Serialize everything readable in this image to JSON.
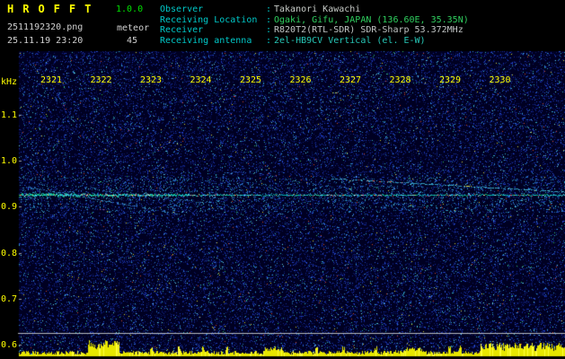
{
  "header": {
    "app_title": "HROFFT",
    "version": "1.0.0",
    "filename": "2511192320.png",
    "mode": "meteor",
    "datetime": "25.11.19 23:20",
    "count": "45",
    "label_color": "#00c8c8",
    "text_color": "#d0d0d0",
    "title_color": "#ffff00",
    "version_color": "#00e000",
    "info": [
      {
        "label": "Observer",
        "value": "Takanori Kawachi",
        "value_color": "#c8ccc8"
      },
      {
        "label": "Receiving Location",
        "value": "Ogaki, Gifu, JAPAN (136.60E, 35.35N)",
        "value_color": "#2fcf5f"
      },
      {
        "label": "Receiver",
        "value": "R820T2(RTL-SDR) SDR-Sharp 53.372MHz",
        "value_color": "#c0c4c4"
      },
      {
        "label": "Receiving antenna",
        "value": "2el-HB9CV Vertical (el. E-W)",
        "value_color": "#27c8b8"
      }
    ]
  },
  "spectrogram": {
    "ylabel": "kHz",
    "x_ticks": [
      "2321",
      "2322",
      "2323",
      "2324",
      "2325",
      "2326",
      "2327",
      "2328",
      "2329",
      "2330"
    ],
    "y_ticks": [
      "1.1",
      "1.0",
      "0.9",
      "0.8",
      "0.7",
      "0.6"
    ],
    "carrier_khz": 0.93,
    "freq_axis_range_khz": [
      0.6,
      1.1
    ],
    "time_span_hhmm": [
      "23:21",
      "23:30"
    ],
    "colors": {
      "background": "#000022",
      "axis_text": "#ffff00",
      "carrier": "#00c0c0",
      "activity_bars": "#e8e800",
      "baseline": "#b8bcc0"
    }
  }
}
